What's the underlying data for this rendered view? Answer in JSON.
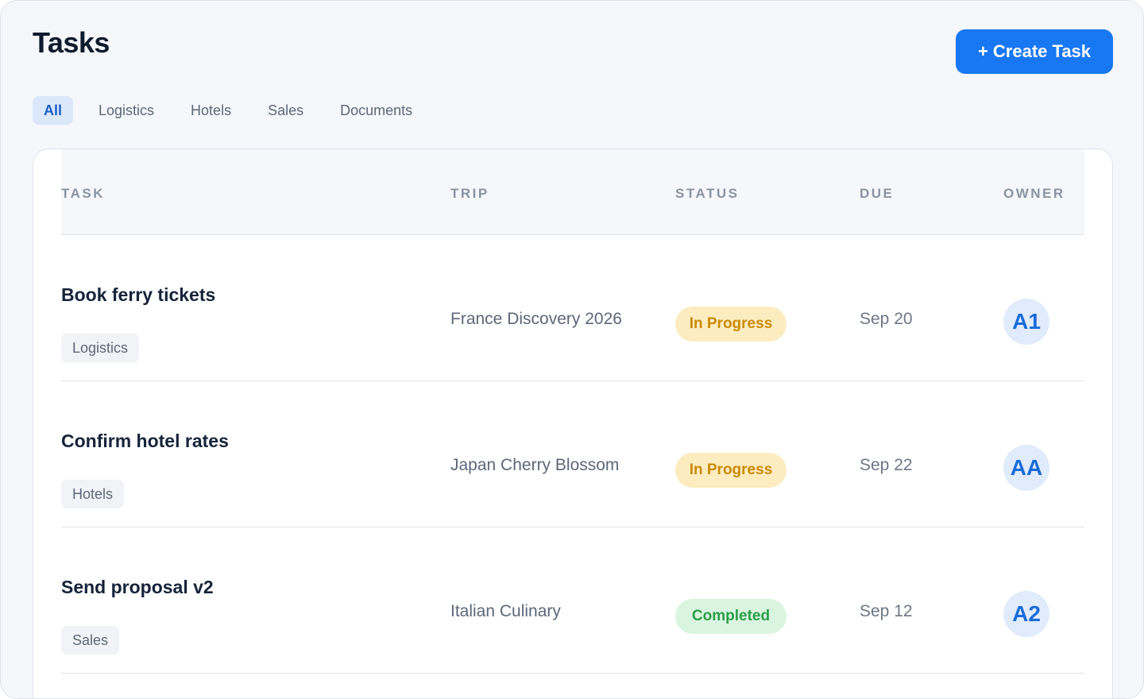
{
  "header": {
    "title": "Tasks",
    "create_button": "+ Create Task"
  },
  "tabs": [
    {
      "label": "All",
      "active": true
    },
    {
      "label": "Logistics",
      "active": false
    },
    {
      "label": "Hotels",
      "active": false
    },
    {
      "label": "Sales",
      "active": false
    },
    {
      "label": "Documents",
      "active": false
    }
  ],
  "table": {
    "columns": [
      "TASK",
      "TRIP",
      "STATUS",
      "DUE",
      "OWNER"
    ],
    "rows": [
      {
        "task": "Book ferry tickets",
        "tag": "Logistics",
        "trip": "France Discovery 2026",
        "status": "In Progress",
        "status_kind": "progress",
        "due": "Sep 20",
        "owner": "A1"
      },
      {
        "task": "Confirm hotel rates",
        "tag": "Hotels",
        "trip": "Japan Cherry Blossom",
        "status": "In Progress",
        "status_kind": "progress",
        "due": "Sep 22",
        "owner": "AA"
      },
      {
        "task": "Send proposal v2",
        "tag": "Sales",
        "trip": "Italian Culinary",
        "status": "Completed",
        "status_kind": "done",
        "due": "Sep 12",
        "owner": "A2"
      }
    ]
  },
  "colors": {
    "accent": "#1877f2",
    "in_progress_bg": "#fdecc0",
    "in_progress_text": "#c98a05",
    "completed_bg": "#d9f5df",
    "completed_text": "#2a9d48"
  }
}
